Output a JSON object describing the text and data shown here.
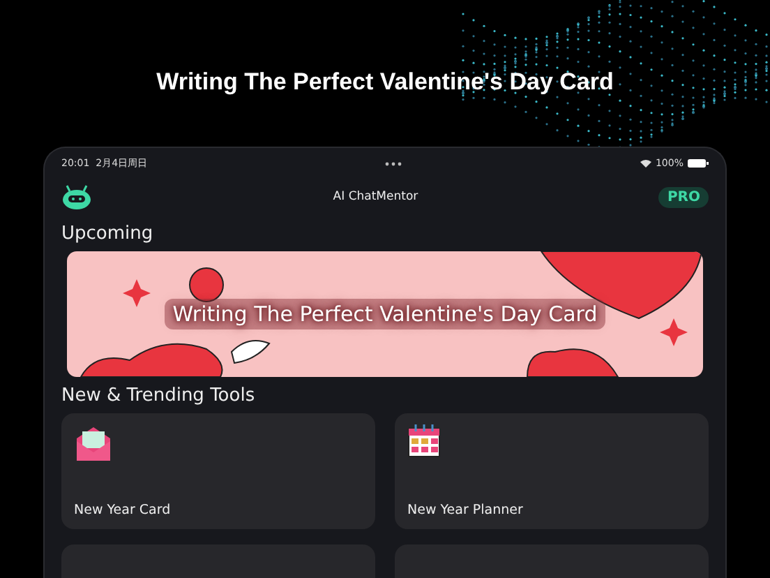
{
  "headline": "Writing The Perfect Valentine's Day Card",
  "status_bar": {
    "time": "20:01",
    "date": "2月4日周日",
    "battery": "100%"
  },
  "header": {
    "title": "AI ChatMentor",
    "badge": "PRO"
  },
  "upcoming": {
    "heading": "Upcoming",
    "banner_title": "Writing The Perfect Valentine's Day Card"
  },
  "tools": {
    "heading": "New & Trending Tools",
    "items": [
      {
        "label": "New Year Card",
        "kind": "envelope"
      },
      {
        "label": "New Year Planner",
        "kind": "calendar"
      },
      {
        "kind": "blank"
      },
      {
        "kind": "blank"
      }
    ]
  }
}
